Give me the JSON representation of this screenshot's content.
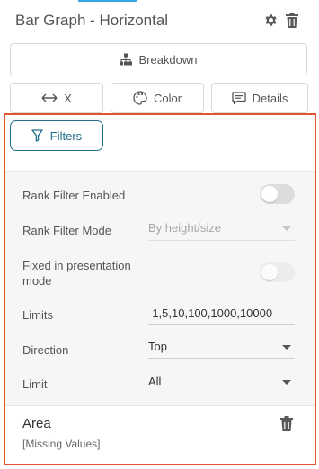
{
  "header": {
    "title": "Bar Graph - Horizontal"
  },
  "buttons": {
    "breakdown": "Breakdown",
    "x": "X",
    "color": "Color",
    "details": "Details",
    "filters": "Filters"
  },
  "filters": {
    "rank_filter_enabled": {
      "label": "Rank Filter Enabled",
      "on": false
    },
    "rank_filter_mode": {
      "label": "Rank Filter Mode",
      "value": "By height/size"
    },
    "fixed_presentation": {
      "label_line1": "Fixed in presentation",
      "label_line2": "mode",
      "on": false
    },
    "limits": {
      "label": "Limits",
      "value": "-1,5,10,100,1000,10000"
    },
    "direction": {
      "label": "Direction",
      "value": "Top"
    },
    "limit": {
      "label": "Limit",
      "value": "All"
    }
  },
  "area": {
    "title": "Area",
    "subtitle": "[Missing Values]"
  },
  "colors": {
    "accent": "#1f6f8b",
    "highlight": "#e0542e",
    "top_accent": "#34a7e0"
  }
}
